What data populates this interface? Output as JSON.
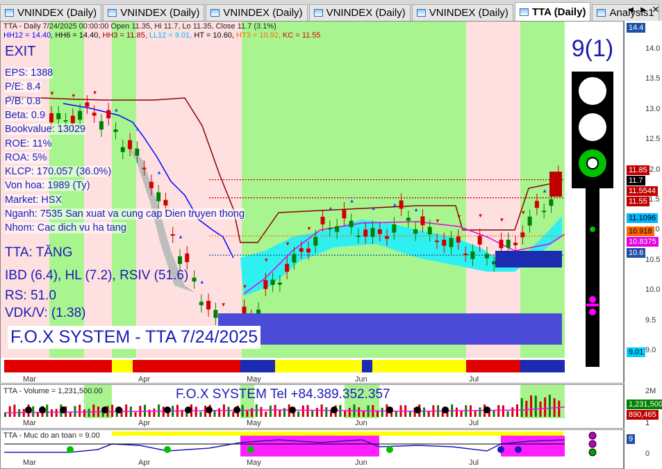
{
  "tabs": [
    {
      "label": "VNINDEX (Daily)",
      "active": false
    },
    {
      "label": "VNINDEX (Daily)",
      "active": false
    },
    {
      "label": "VNINDEX (Daily)",
      "active": false
    },
    {
      "label": "VNINDEX (Daily)",
      "active": false
    },
    {
      "label": "VNINDEX (Daily)",
      "active": false
    },
    {
      "label": "TTA (Daily)",
      "active": true
    },
    {
      "label": "Analysis1",
      "active": false
    }
  ],
  "tab_nav": {
    "prev": "◄",
    "next": "►",
    "close": "✕"
  },
  "price_panel": {
    "header_line1": "TTA - Daily 7/24/2025 00:00:00 Open 11.35, Hi 11.7, Lo 11.35, Close 11.7 (3.1%)",
    "header_line2": [
      {
        "text": "HH12 = 14.40, ",
        "color": "#0000ff"
      },
      {
        "text": "HH6 = 14.40, ",
        "color": "#000"
      },
      {
        "text": "HH3 = 11.85, ",
        "color": "#8b0000"
      },
      {
        "text": "LL12 = 9.01, ",
        "color": "#00b7ff"
      },
      {
        "text": "HT = 10.60, ",
        "color": "#000"
      },
      {
        "text": "HT3 = 10.92, ",
        "color": "#ff6a00"
      },
      {
        "text": "KC = 11.55",
        "color": "#e00000"
      }
    ],
    "signal": "EXIT",
    "fundamentals": [
      "EPS: 1388",
      "P/E: 8.4",
      "P/B: 0.8",
      "Beta: 0.9",
      "Bookvalue: 13029",
      "ROE: 11%",
      "ROA: 5%",
      "KLCP: 170.057 (36.0%)",
      "Von hoa: 1989 (Ty)",
      "Market: HSX",
      "Nganh: 7535 San xuat va cung cap Dien truyen thong",
      "Nhom: Cac dich vu ha tang"
    ],
    "status": "TTA: TĂNG",
    "ibd": "IBD (6.4), HL (7.2), RSIV (51.6)",
    "rs": "RS: 51.0",
    "vdk": "VDK/V:  (1.38)",
    "system_title": "F.O.X SYSTEM - TTA 7/24/2025",
    "score": "9(1)",
    "traffic_light": [
      "white",
      "white",
      "green"
    ],
    "months": [
      "Mar",
      "Apr",
      "May",
      "Jun",
      "Jul"
    ],
    "y_ticks": [
      "14.0",
      "13.5",
      "13.0",
      "12.5",
      "12.0",
      "11.5",
      "11.0",
      "10.5",
      "10.0",
      "9.5",
      "9.0"
    ],
    "y_tags": [
      {
        "text": "14.4",
        "bg": "#1f4fa8",
        "fg": "#fff"
      },
      {
        "text": "11.85",
        "bg": "#c00000",
        "fg": "#fff"
      },
      {
        "text": "11.7",
        "bg": "#000",
        "fg": "#fff"
      },
      {
        "text": "11.5544",
        "bg": "#c00000",
        "fg": "#fff"
      },
      {
        "text": "11.55",
        "bg": "#c00000",
        "fg": "#fff"
      },
      {
        "text": "11.1096",
        "bg": "#00b7ff",
        "fg": "#000"
      },
      {
        "text": "10.918",
        "bg": "#ff6a00",
        "fg": "#000"
      },
      {
        "text": "10.8375",
        "bg": "#e600e6",
        "fg": "#fff"
      },
      {
        "text": "10.6",
        "bg": "#1f4fa8",
        "fg": "#fff"
      },
      {
        "text": "9.01",
        "bg": "#00d0ff",
        "fg": "#000"
      }
    ]
  },
  "volume_panel": {
    "header": "TTA - Volume = 1,231,500.00",
    "phone": "F.O.X SYSTEM Tel +84.389.352.357",
    "y_ticks": [
      "2M",
      "1"
    ],
    "y_tags": [
      {
        "text": "1,231,500",
        "bg": "#008000",
        "fg": "#fff"
      },
      {
        "text": "890,465",
        "bg": "#c00000",
        "fg": "#fff"
      }
    ]
  },
  "safety_panel": {
    "header": "TTA - Muc do an toan = 9.00",
    "y_ticks": [
      "0"
    ],
    "y_tags": [
      {
        "text": "9",
        "bg": "#1f4fa8",
        "fg": "#fff"
      }
    ]
  },
  "chart_data": {
    "type": "line",
    "title": "TTA - Daily",
    "x": [
      "Mar",
      "Apr",
      "May",
      "Jun",
      "Jul"
    ],
    "ylim": [
      8.9,
      14.4
    ],
    "series": [
      {
        "name": "Close",
        "values": [
          12.8,
          12.9,
          13.0,
          12.6,
          12.2,
          11.5,
          10.5,
          9.8,
          9.3,
          9.6,
          10.1,
          10.5,
          10.9,
          11.2,
          11.0,
          10.9,
          11.3,
          11.0,
          10.8,
          10.7,
          10.6,
          10.8,
          11.3,
          11.7
        ]
      }
    ],
    "hh3_values": [
      13.0,
      13.0,
      13.0,
      13.0,
      12.8,
      12.0,
      11.2,
      10.9,
      10.6,
      10.7,
      11.0,
      11.2,
      11.2,
      11.2,
      11.2,
      11.2,
      11.2,
      11.1,
      10.9,
      10.9,
      10.9,
      10.9,
      11.2,
      11.85
    ]
  }
}
